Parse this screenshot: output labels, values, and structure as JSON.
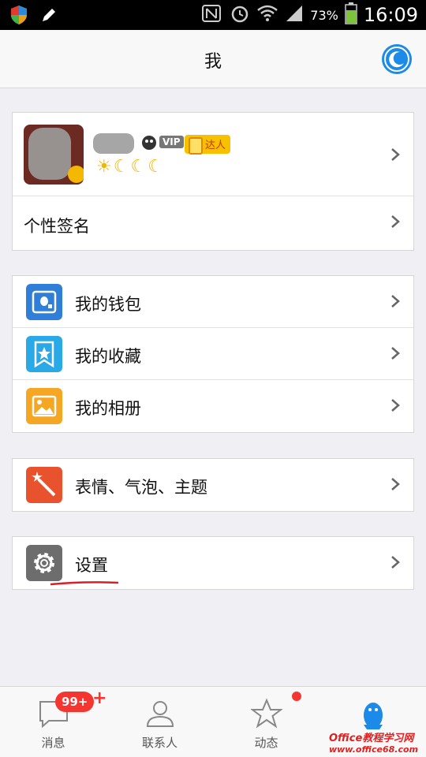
{
  "status_bar": {
    "battery_percent": "73%",
    "time": "16:09"
  },
  "nav": {
    "title": "我"
  },
  "profile": {
    "vip": "VIP",
    "daren": "达人",
    "level_icons": [
      "☀",
      "☾",
      "☾",
      "☾"
    ],
    "signature_label": "个性签名"
  },
  "group1": [
    {
      "label": "我的钱包",
      "icon": "wallet-icon",
      "color": "#2f7fd8"
    },
    {
      "label": "我的收藏",
      "icon": "favorites-icon",
      "color": "#29a9e6"
    },
    {
      "label": "我的相册",
      "icon": "album-icon",
      "color": "#f5a623"
    }
  ],
  "group2": [
    {
      "label": "表情、气泡、主题",
      "icon": "theme-icon",
      "color": "#e8532d"
    }
  ],
  "group3": [
    {
      "label": "设置",
      "icon": "settings-icon",
      "color": "#6d6d6d"
    }
  ],
  "tabbar": {
    "tabs": [
      {
        "label": "消息",
        "badge": "99+"
      },
      {
        "label": "联系人"
      },
      {
        "label": "动态"
      },
      {
        "label": ""
      }
    ]
  },
  "watermark": {
    "line1": "Office教程学习网",
    "line2": "www.office68.com"
  }
}
